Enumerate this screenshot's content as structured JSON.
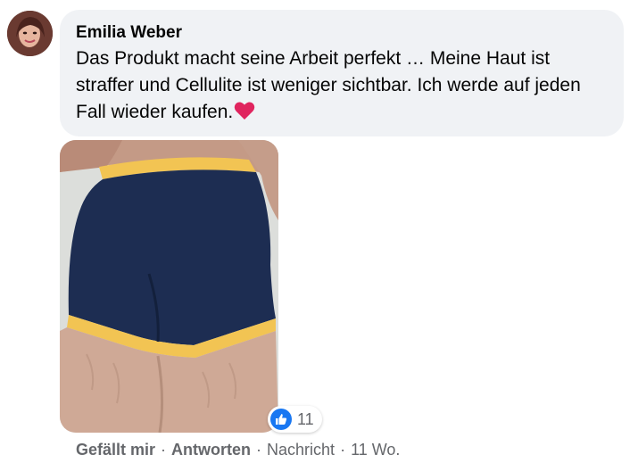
{
  "comment": {
    "author": "Emilia Weber",
    "text": "Das Produkt macht seine Arbeit perfekt … Meine Haut ist straffer und Cellulite ist weniger sichtbar. Ich werde auf jeden Fall wieder kaufen.",
    "emoji": "heart",
    "reaction_count": "11",
    "reaction_type": "like-icon"
  },
  "actions": {
    "like": "Gefällt mir",
    "reply": "Antworten",
    "message": "Nachricht",
    "separator": "·",
    "time": "11 Wo."
  },
  "colors": {
    "bubble_bg": "#f0f2f5",
    "like_blue": "#1877f2",
    "secondary_text": "#65676b",
    "heart_red": "#e0245e",
    "shorts_navy": "#1d2d52",
    "waistband_yellow": "#f2c453"
  }
}
